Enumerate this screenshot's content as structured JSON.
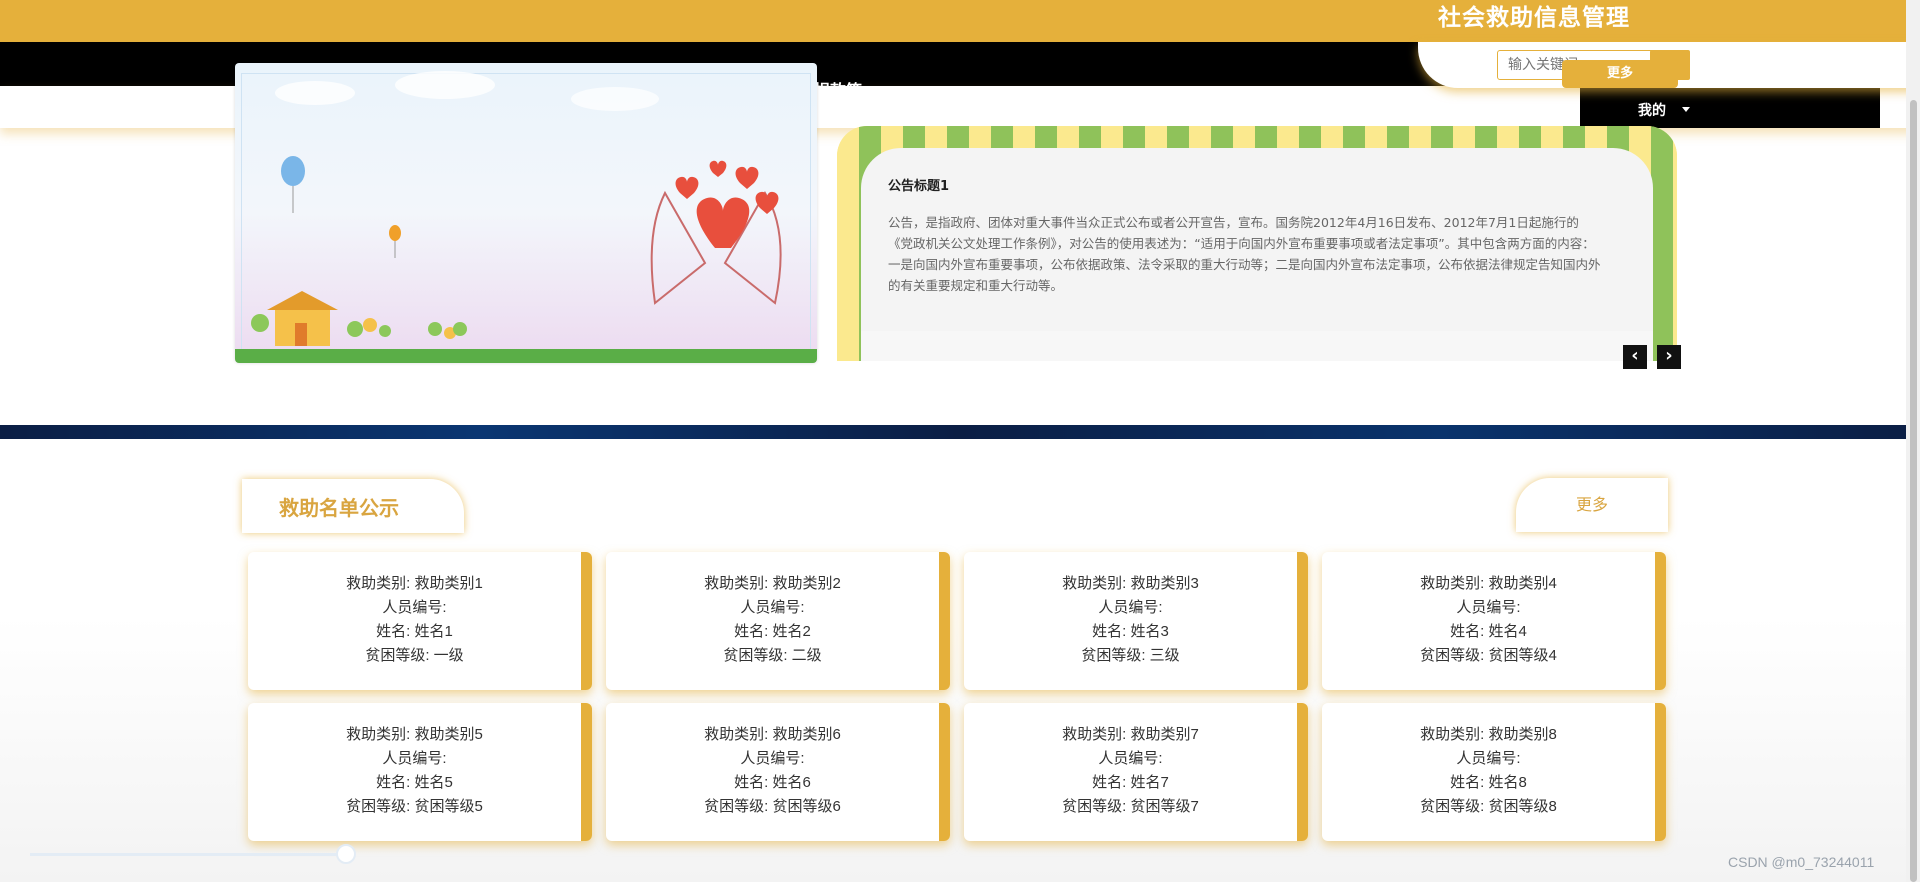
{
  "header": {
    "site_title": "社会救助信息管理",
    "search_placeholder": "输入关键词",
    "more_label": "更多",
    "nav_donate": "捐款箱",
    "nav_mine": "我的"
  },
  "notice": {
    "title": "公告标题1",
    "text": "公告，是指政府、团体对重大事件当众正式公布或者公开宣告，宣布。国务院2012年4月16日发布、2012年7月1日起施行的《党政机关公文处理工作条例》，对公告的使用表述为：“适用于向国内外宣布重要事项或者法定事项”。其中包含两方面的内容：一是向国内外宣布重要事项，公布依据政策、法令采取的重大行动等；二是向国内外宣布法定事项，公布依据法律规定告知国内外的有关重要规定和重大行动等。",
    "prev_icon": "‹",
    "next_icon": "›"
  },
  "section": {
    "title": "救助名单公示",
    "more_label": "更多"
  },
  "cards": [
    {
      "category": "救助类别: 救助类别1",
      "code": "人员编号:",
      "name": "姓名: 姓名1",
      "level": "贫困等级: 一级"
    },
    {
      "category": "救助类别: 救助类别2",
      "code": "人员编号:",
      "name": "姓名: 姓名2",
      "level": "贫困等级: 二级"
    },
    {
      "category": "救助类别: 救助类别3",
      "code": "人员编号:",
      "name": "姓名: 姓名3",
      "level": "贫困等级: 三级"
    },
    {
      "category": "救助类别: 救助类别4",
      "code": "人员编号:",
      "name": "姓名: 姓名4",
      "level": "贫困等级: 贫困等级4"
    },
    {
      "category": "救助类别: 救助类别5",
      "code": "人员编号:",
      "name": "姓名: 姓名5",
      "level": "贫困等级: 贫困等级5"
    },
    {
      "category": "救助类别: 救助类别6",
      "code": "人员编号:",
      "name": "姓名: 姓名6",
      "level": "贫困等级: 贫困等级6"
    },
    {
      "category": "救助类别: 救助类别7",
      "code": "人员编号:",
      "name": "姓名: 姓名7",
      "level": "贫困等级: 贫困等级7"
    },
    {
      "category": "救助类别: 救助类别8",
      "code": "人员编号:",
      "name": "姓名: 姓名8",
      "level": "贫困等级: 贫困等级8"
    }
  ],
  "watermark": "CSDN @m0_73244011",
  "colors": {
    "accent": "#e5b03b",
    "nav": "#000000",
    "banner": "#0b2a5a"
  }
}
